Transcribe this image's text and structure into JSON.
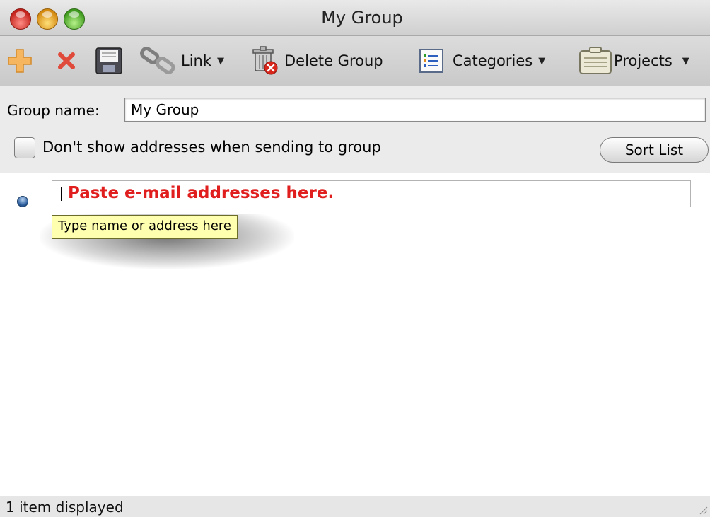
{
  "window": {
    "title": "My Group"
  },
  "toolbar": {
    "items": [
      {
        "id": "new",
        "icon": "add-icon"
      },
      {
        "id": "delete",
        "icon": "delete-x-icon"
      },
      {
        "id": "save",
        "icon": "save-icon"
      },
      {
        "id": "link",
        "icon": "link-icon",
        "label": "Link",
        "has_menu": true
      },
      {
        "id": "delete_group",
        "icon": "trash-icon",
        "label": "Delete Group"
      },
      {
        "id": "categories",
        "icon": "categories-icon",
        "label": "Categories",
        "has_menu": true
      },
      {
        "id": "projects",
        "icon": "projects-icon",
        "label": "Projects",
        "has_menu": true
      }
    ]
  },
  "form": {
    "group_name_label": "Group name:",
    "group_name_value": "My Group",
    "dont_show_label": "Don't show addresses when sending to group",
    "dont_show_checked": false,
    "sort_button": "Sort List"
  },
  "list": {
    "input_text": "Paste e-mail addresses here.",
    "tooltip": "Type name or address here"
  },
  "status": {
    "text": "1 item displayed"
  },
  "colors": {
    "placeholder_red": "#e01e1e",
    "tooltip_bg": "#ffffb0",
    "add_orange": "#f4a640",
    "delete_red": "#e04a3a"
  }
}
